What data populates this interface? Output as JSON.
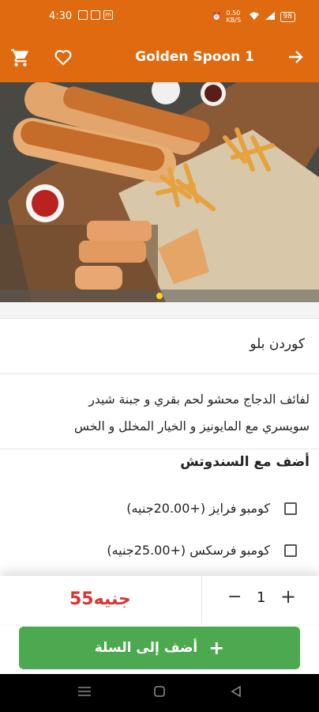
{
  "status": {
    "time": "4:30",
    "net": "0.50 KB/S",
    "battery": "98"
  },
  "app_bar": {
    "title": "Golden Spoon 1"
  },
  "product": {
    "name": "كوردن بلو",
    "description_line1": "لفائف الدجاج محشو لحم بقري و جبنة شيدر",
    "description_line2": "سويسري مع المايونيز و الخيار المخلل و الخس"
  },
  "addons": {
    "title": "أضف مع السندوتش",
    "options": [
      {
        "label": "كومبو فرايز (+20.00جنيه)",
        "checked": false
      },
      {
        "label": "كومبو فرسكس (+25.00جنيه)",
        "checked": false
      }
    ]
  },
  "order": {
    "price": "55جنيه",
    "quantity": "1",
    "minus": "−",
    "plus": "+"
  },
  "add_button": {
    "label": "أضف إلى السلة",
    "icon": "+"
  },
  "colors": {
    "primary": "#e06a0f",
    "price": "#d93432",
    "button": "#4ca94f"
  }
}
